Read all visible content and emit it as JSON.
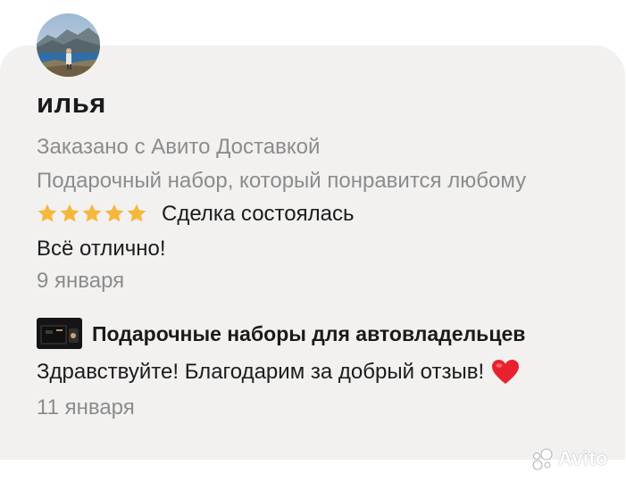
{
  "review": {
    "author_name": "илья",
    "delivery_note": "Заказано с Авито Доставкой",
    "item_title": "Подарочный набор, который понравится любому",
    "rating": 5,
    "rating_max": 5,
    "deal_status": "Сделка состоялась",
    "text": "Всё отлично!",
    "date": "9 января"
  },
  "reply": {
    "seller_name": "Подарочные наборы для автовладельцев",
    "text": "Здравствуйте! Благодарим за добрый отзыв!",
    "emoji": "heart-emoji",
    "date": "11 января"
  },
  "watermark": {
    "text": "Avito"
  },
  "colors": {
    "card_background": "#f2f1f0",
    "muted_text": "#8c8c8c",
    "star": "#f5b73d",
    "heart": "#e8212e"
  }
}
